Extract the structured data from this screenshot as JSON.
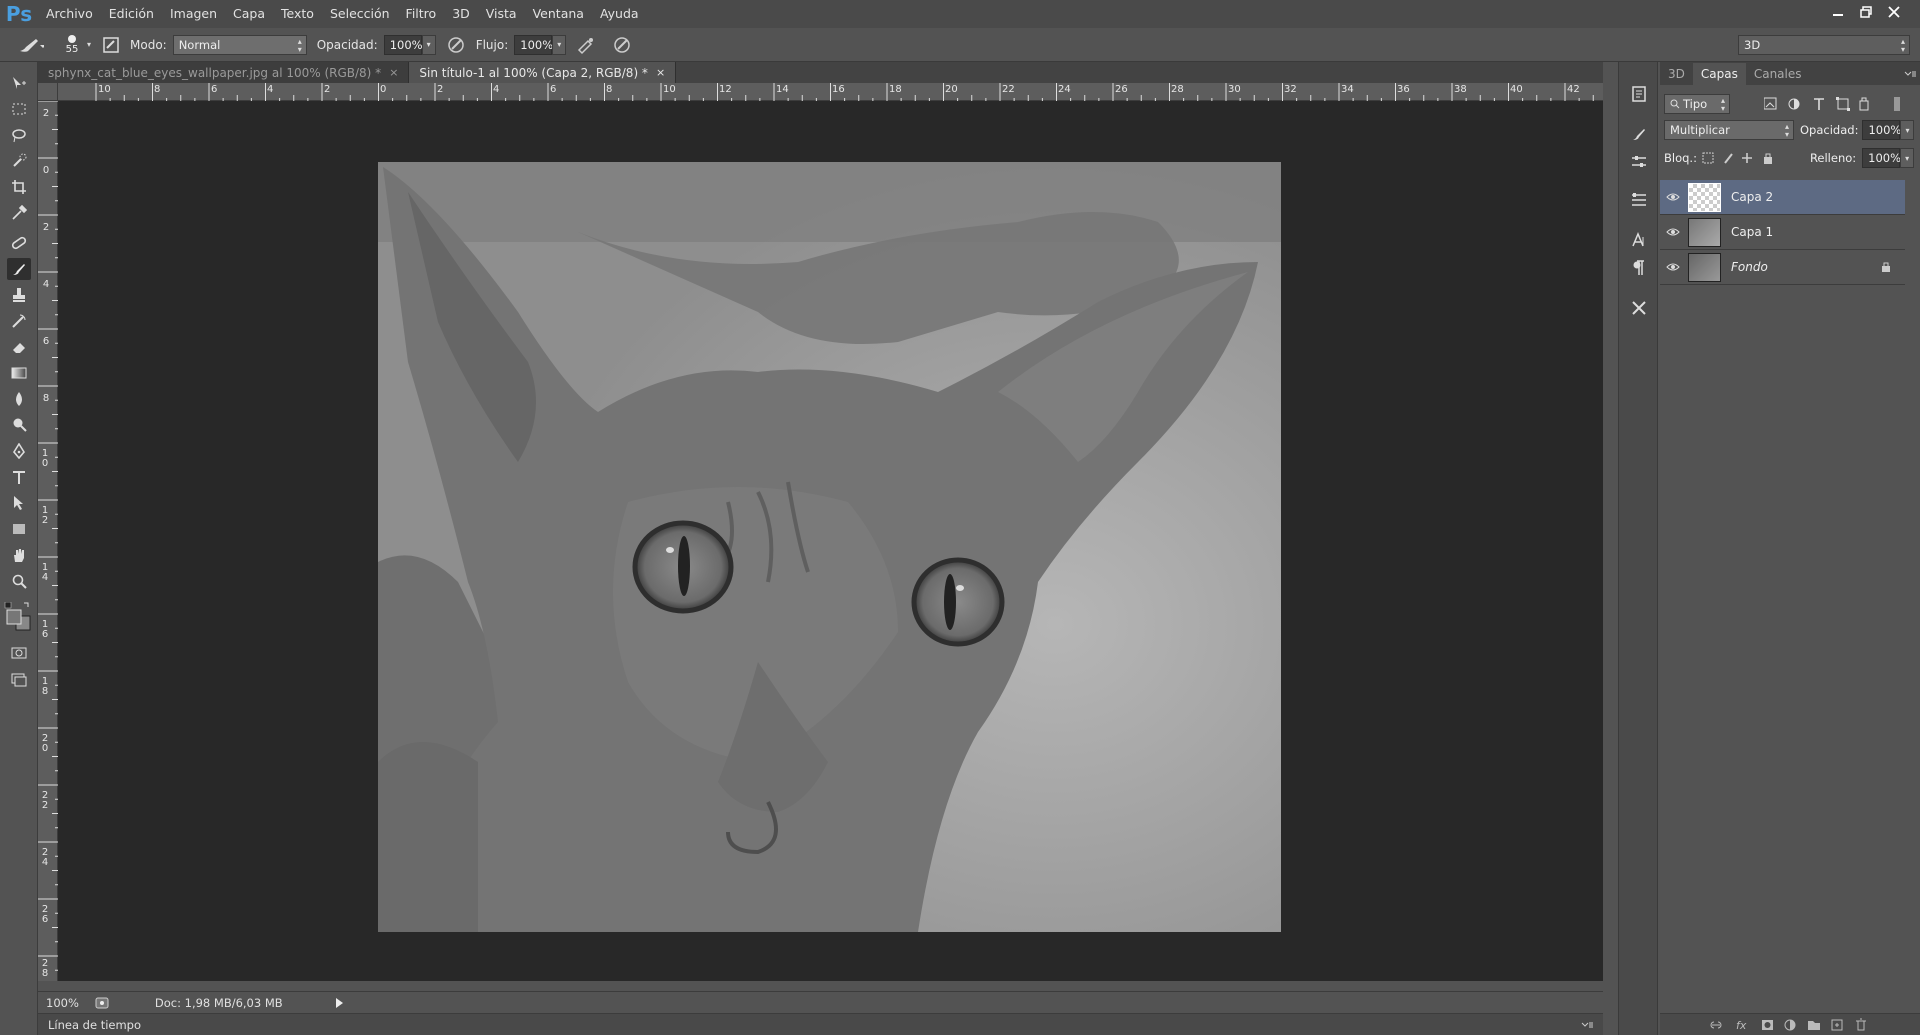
{
  "app": {
    "logo": "Ps"
  },
  "menu": [
    "Archivo",
    "Edición",
    "Imagen",
    "Capa",
    "Texto",
    "Selección",
    "Filtro",
    "3D",
    "Vista",
    "Ventana",
    "Ayuda"
  ],
  "options": {
    "brush_size": "55",
    "mode_label": "Modo:",
    "mode_value": "Normal",
    "opacity_label": "Opacidad:",
    "opacity_value": "100%",
    "flow_label": "Flujo:",
    "flow_value": "100%",
    "workspace_value": "3D"
  },
  "tabs": [
    {
      "label": "sphynx_cat_blue_eyes_wallpaper.jpg al 100% (RGB/8) *",
      "close": "×"
    },
    {
      "label": "Sin título-1 al 100% (Capa 2, RGB/8) *",
      "close": "×"
    }
  ],
  "ruler_h": [
    "10",
    "8",
    "6",
    "4",
    "2",
    "0",
    "2",
    "4",
    "6",
    "8",
    "10",
    "12",
    "14",
    "16",
    "18",
    "20",
    "22",
    "24",
    "26",
    "28",
    "30",
    "32",
    "34",
    "36",
    "38",
    "40",
    "42"
  ],
  "ruler_v": [
    "2",
    "0",
    "2",
    "4",
    "6",
    "8",
    "1 0",
    "1 2",
    "1 4",
    "1 6",
    "1 8",
    "2 0",
    "2 2",
    "2 4",
    "2 6",
    "2 8"
  ],
  "status": {
    "zoom": "100%",
    "doc": "Doc: 1,98 MB/6,03 MB"
  },
  "timeline": {
    "label": "Línea de tiempo"
  },
  "layers_panel": {
    "tabs": [
      "3D",
      "Capas",
      "Canales"
    ],
    "filter_type": "Tipo",
    "blend_mode": "Multiplicar",
    "opacity_label": "Opacidad:",
    "opacity_value": "100%",
    "lock_label": "Bloq.:",
    "fill_label": "Relleno:",
    "fill_value": "100%",
    "layers": [
      {
        "name": "Capa 2",
        "selected": true
      },
      {
        "name": "Capa 1",
        "selected": false
      },
      {
        "name": "Fondo",
        "selected": false,
        "locked": true
      }
    ]
  },
  "colors": {
    "selection": "#5d6a83",
    "logo": "#4a9fe0",
    "workspace": "#282828"
  }
}
